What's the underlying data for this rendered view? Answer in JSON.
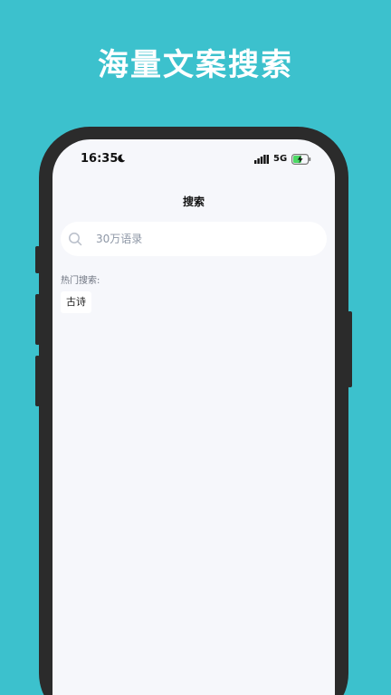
{
  "banner": {
    "headline": "海量文案搜索"
  },
  "status_bar": {
    "time": "16:35",
    "network": "5G"
  },
  "header": {
    "title": "搜索"
  },
  "search": {
    "placeholder": "30万语录",
    "value": ""
  },
  "hot_search": {
    "label": "热门搜索:",
    "tags": [
      "古诗"
    ]
  },
  "colors": {
    "background": "#3cc1cd",
    "phone_frame": "#2b2b2b",
    "screen": "#f6f7fb",
    "battery_charge": "#4cd964"
  }
}
